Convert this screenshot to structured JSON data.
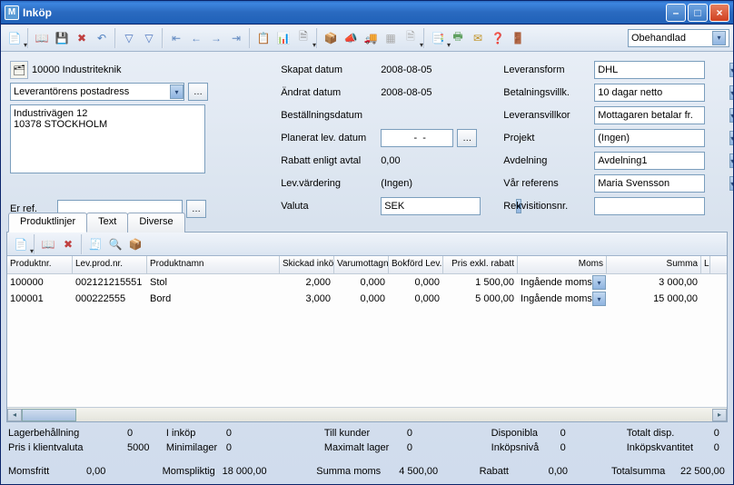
{
  "window": {
    "title": "Inköp"
  },
  "toolbar": {
    "status_combo": "Obehandlad"
  },
  "supplier": {
    "id_name": "10000 Industriteknik",
    "address_type": "Leverantörens postadress",
    "address": "Industrivägen 12\n10378 STOCKHOLM",
    "er_ref_label": "Er ref.",
    "er_ref_value": ""
  },
  "mid": {
    "skapat_datum_lbl": "Skapat datum",
    "skapat_datum": "2008-08-05",
    "andrat_datum_lbl": "Ändrat datum",
    "andrat_datum": "2008-08-05",
    "bestallningsdatum_lbl": "Beställningsdatum",
    "bestallningsdatum": "",
    "planerat_lev_lbl": "Planerat lev. datum",
    "planerat_lev": "  -  -",
    "rabatt_enligt_lbl": "Rabatt enligt avtal",
    "rabatt_enligt": "0,00",
    "lev_vardering_lbl": "Lev.värdering",
    "lev_vardering": "(Ingen)",
    "valuta_lbl": "Valuta",
    "valuta": "SEK"
  },
  "right": {
    "leveransform_lbl": "Leveransform",
    "leveransform": "DHL",
    "betalvillk_lbl": "Betalningsvillk.",
    "betalvillk": "10 dagar netto",
    "leveransvillkor_lbl": "Leveransvillkor",
    "leveransvillkor": "Mottagaren betalar fr.",
    "projekt_lbl": "Projekt",
    "projekt": "(Ingen)",
    "avdelning_lbl": "Avdelning",
    "avdelning": "Avdelning1",
    "var_referens_lbl": "Vår referens",
    "var_referens": "Maria Svensson",
    "rekvisitionsnr_lbl": "Rekvisitionsnr.",
    "rekvisitionsnr": ""
  },
  "tabs": {
    "t1": "Produktlinjer",
    "t2": "Text",
    "t3": "Diverse"
  },
  "grid": {
    "headers": {
      "produktnr": "Produktnr.",
      "levprodnr": "Lev.prod.nr.",
      "produktnamn": "Produktnamn",
      "skickad": "Skickad inköpso",
      "varumott": "Varumottagn",
      "bokford": "Bokförd Lev.",
      "pris_exkl": "Pris exkl. rabatt",
      "moms": "Moms",
      "summa": "Summa",
      "l": "L"
    },
    "rows": [
      {
        "produktnr": "100000",
        "levprodnr": "002121215551",
        "produktnamn": "Stol",
        "skickad": "2,000",
        "varumott": "0,000",
        "bokford": "0,000",
        "pris": "1 500,00",
        "moms": "Ingående moms",
        "summa": "3 000,00"
      },
      {
        "produktnr": "100001",
        "levprodnr": "000222555",
        "produktnamn": "Bord",
        "skickad": "3,000",
        "varumott": "0,000",
        "bokford": "0,000",
        "pris": "5 000,00",
        "moms": "Ingående moms",
        "summa": "15 000,00"
      }
    ]
  },
  "bottom": {
    "lagerbeh_lbl": "Lagerbehållning",
    "lagerbeh": "0",
    "iinkop_lbl": "I inköp",
    "iinkop": "0",
    "till_kunder_lbl": "Till kunder",
    "till_kunder": "0",
    "disponibla_lbl": "Disponibla",
    "disponibla": "0",
    "totalt_disp_lbl": "Totalt disp.",
    "totalt_disp": "0",
    "pris_klient_lbl": "Pris i klientvaluta",
    "pris_klient": "5000",
    "minimilager_lbl": "Minimilager",
    "minimilager": "0",
    "max_lager_lbl": "Maximalt lager",
    "max_lager": "0",
    "inkopsniva_lbl": "Inköpsnivå",
    "inkopsniva": "0",
    "inkopskvant_lbl": "Inköpskvantitet",
    "inkopskvant": "0",
    "momsfritt_lbl": "Momsfritt",
    "momsfritt": "0,00",
    "momspliktig_lbl": "Momspliktig",
    "momspliktig": "18 000,00",
    "summa_moms_lbl": "Summa moms",
    "summa_moms": "4 500,00",
    "rabatt_lbl": "Rabatt",
    "rabatt": "0,00",
    "totalsumma_lbl": "Totalsumma",
    "totalsumma": "22 500,00"
  }
}
